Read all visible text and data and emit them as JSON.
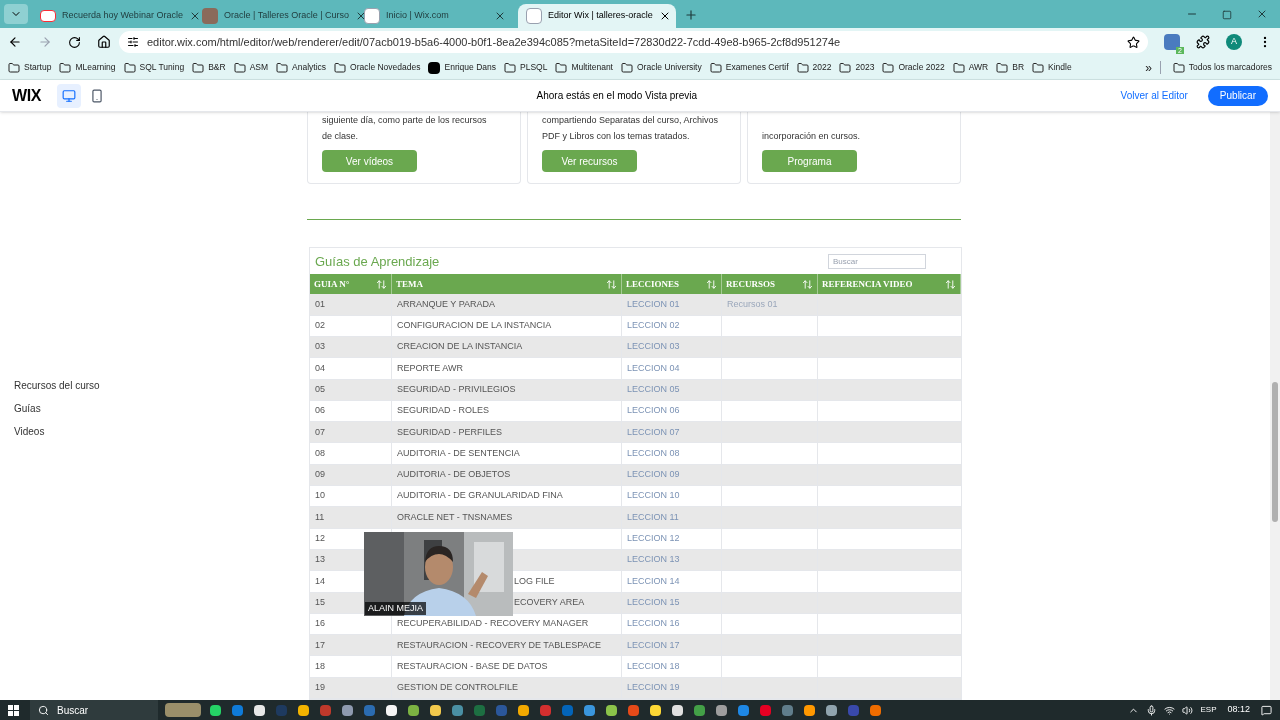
{
  "browser": {
    "tabs": [
      {
        "title": "Recuerda hoy Webinar Oracle",
        "kind": "mail",
        "selected": false
      },
      {
        "title": "Oracle | Talleres Oracle | Curso",
        "selected": false
      },
      {
        "title": "Inicio | Wix.com",
        "kind": "wix",
        "selected": false
      },
      {
        "title": "Editor Wix | talleres-oracle",
        "kind": "wix",
        "selected": true
      }
    ],
    "url": "editor.wix.com/html/editor/web/renderer/edit/07acb019-b5a6-4000-b0f1-8ea2e394c085?metaSiteId=72830d22-7cdd-49e8-b965-2cf8d951274e",
    "extension_badge": "2",
    "profile": "A",
    "bookmarks": [
      {
        "label": "Startup",
        "kind": "folder"
      },
      {
        "label": "MLearning",
        "kind": "folder"
      },
      {
        "label": "SQL Tuning",
        "kind": "folder"
      },
      {
        "label": "B&R",
        "kind": "folder"
      },
      {
        "label": "ASM",
        "kind": "folder"
      },
      {
        "label": "Analytics",
        "kind": "folder"
      },
      {
        "label": "Oracle Novedades",
        "kind": "folder"
      },
      {
        "label": "Enrique Dans",
        "kind": "site"
      },
      {
        "label": "PLSQL",
        "kind": "folder"
      },
      {
        "label": "Multitenant",
        "kind": "folder"
      },
      {
        "label": "Oracle University",
        "kind": "folder"
      },
      {
        "label": "Examenes Certif",
        "kind": "folder"
      },
      {
        "label": "2022",
        "kind": "folder"
      },
      {
        "label": "2023",
        "kind": "folder"
      },
      {
        "label": "Oracle 2022",
        "kind": "folder"
      },
      {
        "label": "AWR",
        "kind": "folder"
      },
      {
        "label": "BR",
        "kind": "folder"
      },
      {
        "label": "Kindle",
        "kind": "folder"
      }
    ],
    "more_bookmarks": "»",
    "all_bookmarks": "Todos los marcadores"
  },
  "wix_bar": {
    "logo": "WIX",
    "devices": [
      {
        "kind": "desktop",
        "selected": true
      },
      {
        "kind": "mobile",
        "selected": false
      }
    ],
    "notice": "Ahora estás en el modo Vista previa",
    "back_link": "Volver al Editor",
    "publish": "Publicar"
  },
  "side_nav": [
    "Recursos del curso",
    "Guías",
    "Videos"
  ],
  "cards": [
    {
      "lines": [
        "siguiente día, como parte de los recursos",
        "de clase."
      ],
      "button": "Ver vídeos"
    },
    {
      "lines": [
        "compartiendo Separatas del curso, Archivos",
        "PDF y Libros con los temas tratados."
      ],
      "button": "Ver recursos"
    },
    {
      "lines": [
        "incorporación en cursos."
      ],
      "button": "Programa"
    }
  ],
  "table": {
    "title": "Guías de Aprendizaje",
    "search_placeholder": "Buscar",
    "columns": [
      "GUIA N°",
      "TEMA",
      "LECCIONES",
      "RECURSOS",
      "REFERENCIA VIDEO"
    ],
    "rows": [
      {
        "num": "01",
        "tema": "ARRANQUE Y PARADA",
        "leccion": "LECCION 01",
        "recursos": "Recursos 01"
      },
      {
        "num": "02",
        "tema": "CONFIGURACION DE LA INSTANCIA",
        "leccion": "LECCION 02"
      },
      {
        "num": "03",
        "tema": "CREACION DE LA INSTANCIA",
        "leccion": "LECCION 03"
      },
      {
        "num": "04",
        "tema": "REPORTE AWR",
        "leccion": "LECCION 04"
      },
      {
        "num": "05",
        "tema": "SEGURIDAD - PRIVILEGIOS",
        "leccion": "LECCION 05"
      },
      {
        "num": "06",
        "tema": "SEGURIDAD - ROLES",
        "leccion": "LECCION 06"
      },
      {
        "num": "07",
        "tema": "SEGURIDAD - PERFILES",
        "leccion": "LECCION 07"
      },
      {
        "num": "08",
        "tema": "AUDITORIA - DE SENTENCIA",
        "leccion": "LECCION 08"
      },
      {
        "num": "09",
        "tema": "AUDITORIA - DE OBJETOS",
        "leccion": "LECCION 09"
      },
      {
        "num": "10",
        "tema": "AUDITORIA - DE GRANULARIDAD FINA",
        "leccion": "LECCION 10"
      },
      {
        "num": "11",
        "tema": "ORACLE NET - TNSNAMES",
        "leccion": "LECCION 11"
      },
      {
        "num": "12",
        "leccion": "LECCION 12",
        "covered": true
      },
      {
        "num": "13",
        "leccion": "LECCION 13",
        "covered": true
      },
      {
        "num": "14",
        "tema": "LOG FILE",
        "leccion": "LECCION 14",
        "covered": true
      },
      {
        "num": "15",
        "tema": "ECOVERY AREA",
        "leccion": "LECCION 15",
        "covered": true
      },
      {
        "num": "16",
        "tema": "RECUPERABILIDAD - RECOVERY MANAGER",
        "leccion": "LECCION 16"
      },
      {
        "num": "17",
        "tema": "RESTAURACION - RECOVERY DE TABLESPACE",
        "leccion": "LECCION 17"
      },
      {
        "num": "18",
        "tema": "RESTAURACION - BASE DE DATOS",
        "leccion": "LECCION 18"
      },
      {
        "num": "19",
        "tema": "GESTION DE CONTROLFILE",
        "leccion": "LECCION 19"
      }
    ]
  },
  "video_overlay": {
    "kind": "picture",
    "name": "ALAIN MEJIA"
  },
  "taskbar": {
    "search": "Buscar",
    "apps": [
      {
        "color": "#25d366"
      },
      {
        "color": "#0f7bd8"
      },
      {
        "color": "#e8e8e8"
      },
      {
        "color": "#1e3a5f"
      },
      {
        "color": "#f4b400"
      },
      {
        "color": "#c0392b"
      },
      {
        "color": "#8e9aaf"
      },
      {
        "color": "#2b6cb0"
      },
      {
        "color": "#f5f5f5"
      },
      {
        "color": "#7cb342"
      },
      {
        "color": "#f2c94c"
      },
      {
        "color": "#4a90a4"
      },
      {
        "color": "#1d6f42"
      },
      {
        "color": "#2b579a"
      },
      {
        "color": "#f2a900"
      },
      {
        "color": "#d32f2f"
      },
      {
        "color": "#0364b8"
      },
      {
        "color": "#3a96dd"
      },
      {
        "color": "#8bc34a"
      },
      {
        "color": "#e64a19"
      },
      {
        "color": "#fdd835"
      },
      {
        "color": "#e0e0e0"
      },
      {
        "color": "#43a047"
      },
      {
        "color": "#9e9e9e"
      },
      {
        "color": "#1e88e5"
      },
      {
        "color": "#e60023"
      },
      {
        "color": "#607d8b"
      },
      {
        "color": "#ff9800"
      },
      {
        "color": "#90a4ae"
      },
      {
        "color": "#3949ab"
      },
      {
        "color": "#ef6c00"
      }
    ],
    "language": "ESP",
    "time": "08:12"
  }
}
